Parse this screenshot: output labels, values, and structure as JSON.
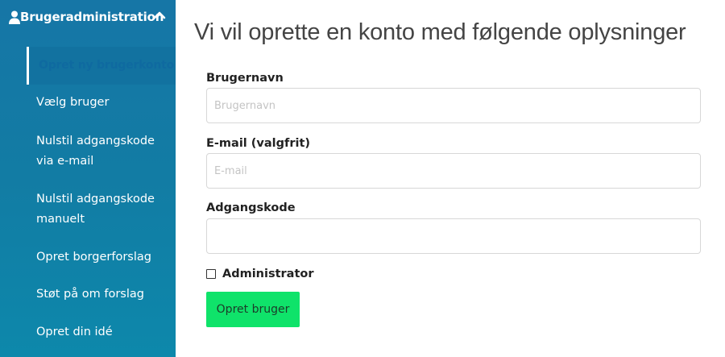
{
  "sidebar": {
    "title": "Brugeradministration",
    "header_icon": "user-icon",
    "toggle_icon": "chevron-up-icon",
    "active_item": "Opret ny brugerkonto",
    "items": [
      {
        "label": "Vælg bruger"
      },
      {
        "label": "Nulstil adgangskode via e-mail"
      },
      {
        "label": "Nulstil adgangskode manuelt"
      },
      {
        "label": "Opret borgerforslag"
      },
      {
        "label": "Støt på om forslag"
      },
      {
        "label": "Opret din idé"
      }
    ]
  },
  "form": {
    "title": "Vi vil oprette en konto med følgende oplysninger",
    "username": {
      "label": "Brugernavn",
      "placeholder": "Brugernavn",
      "value": ""
    },
    "email": {
      "label": "E-mail (valgfrit)",
      "placeholder": "E-mail",
      "value": ""
    },
    "password": {
      "label": "Adgangskode",
      "placeholder": "",
      "value": ""
    },
    "admin_checkbox": {
      "label": "Administrator",
      "checked": false
    },
    "submit_label": "Opret bruger"
  },
  "colors": {
    "sidebar_bg": "#1676a6",
    "submit_bg": "#0fe36a",
    "active_indicator": "#ffffff"
  }
}
